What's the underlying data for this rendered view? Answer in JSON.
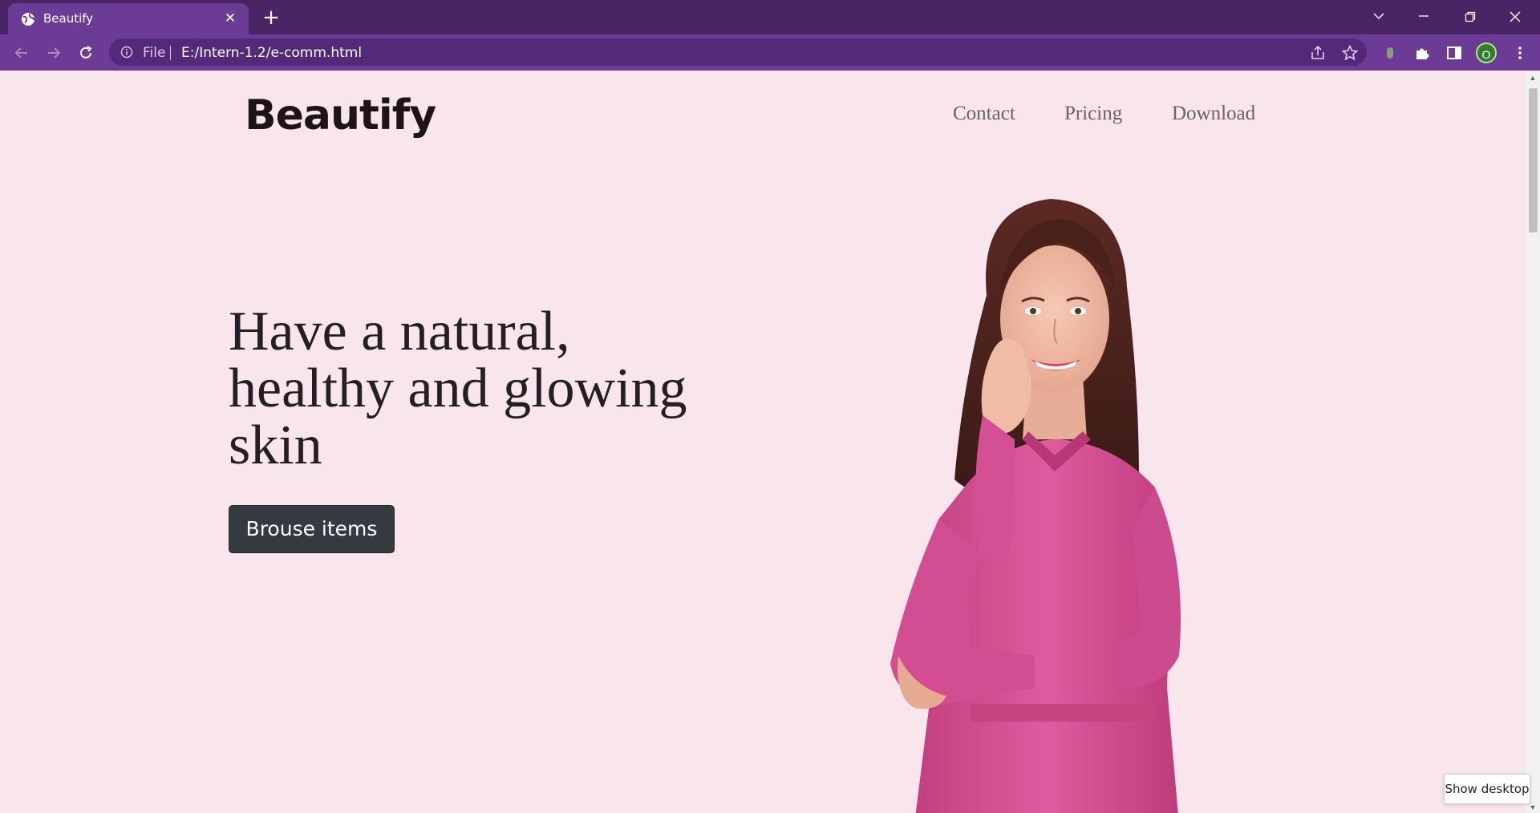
{
  "browser": {
    "tab": {
      "title": "Beautify",
      "close": "✕"
    },
    "new_tab": "+",
    "address": {
      "scheme_label": "File",
      "url": "E:/Intern-1.2/e-comm.html"
    },
    "profile_initial": "O",
    "window_controls": [
      "chevron-down",
      "minimize",
      "restore",
      "close"
    ]
  },
  "page": {
    "brand": "Beautify",
    "nav": [
      {
        "label": "Contact"
      },
      {
        "label": "Pricing"
      },
      {
        "label": "Download"
      }
    ],
    "hero": {
      "title_lines": [
        "Have a natural,",
        "healthy and glowing",
        "skin"
      ],
      "cta": "Brouse items"
    },
    "colors": {
      "background": "#f8e6ec",
      "button": "#343a40",
      "dress": "#d94f97",
      "chrome": "#6c3b96"
    }
  },
  "tooltip": "Show desktop"
}
